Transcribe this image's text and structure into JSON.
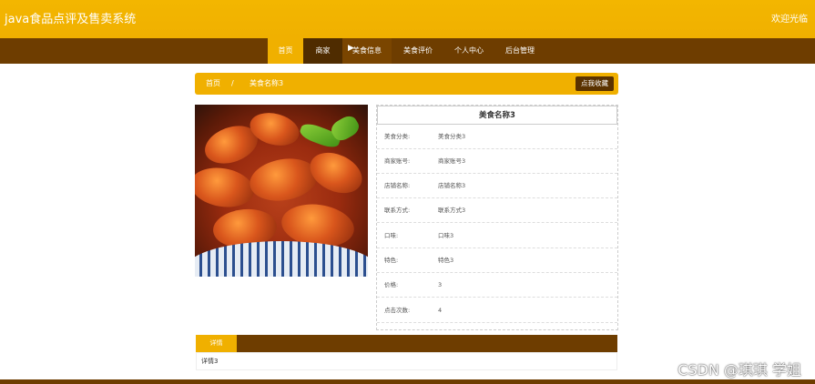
{
  "header": {
    "title": "java食品点评及售卖系统",
    "welcome": "欢迎光临"
  },
  "nav": {
    "items": [
      "首页",
      "商家",
      "美食信息",
      "美食评价",
      "个人中心",
      "后台管理"
    ]
  },
  "breadcrumb": {
    "home": "首页",
    "separator": "/",
    "current": "美食名称3",
    "favorite_button": "点我收藏"
  },
  "detail": {
    "title": "美食名称3",
    "rows": [
      {
        "label": "美食分类:",
        "value": "美食分类3"
      },
      {
        "label": "商家账号:",
        "value": "商家账号3"
      },
      {
        "label": "店铺名称:",
        "value": "店铺名称3"
      },
      {
        "label": "联系方式:",
        "value": "联系方式3"
      },
      {
        "label": "口味:",
        "value": "口味3"
      },
      {
        "label": "特色:",
        "value": "特色3"
      },
      {
        "label": "价格:",
        "value": "3"
      },
      {
        "label": "点击次数:",
        "value": "4"
      }
    ]
  },
  "tabs": {
    "active": "详情",
    "content": "详情3"
  },
  "watermark": "CSDN @琪琪 学姐",
  "colors": {
    "accent": "#f0b000",
    "nav_bg": "#6e3d00",
    "dark_button": "#5a3200"
  }
}
